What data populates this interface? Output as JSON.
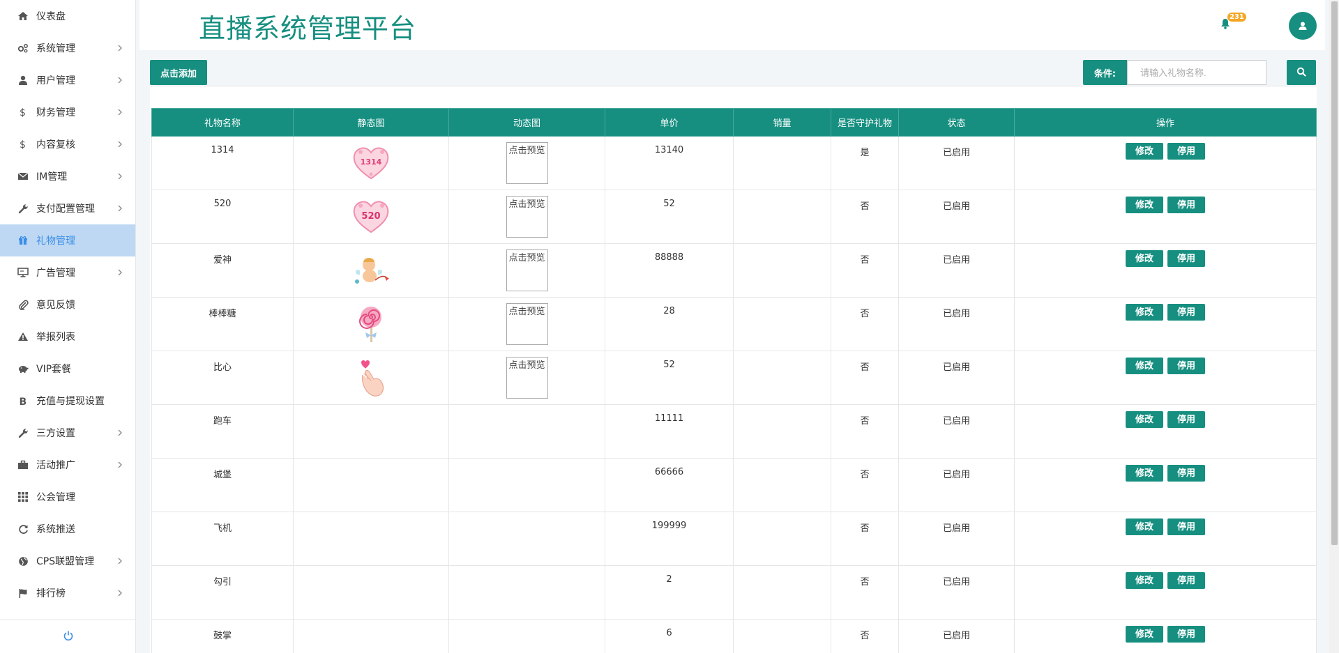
{
  "header": {
    "title": "直播系统管理平台",
    "notification_count": "231"
  },
  "sidebar": {
    "items": [
      {
        "label": "仪表盘",
        "icon": "home-icon",
        "has_children": false
      },
      {
        "label": "系统管理",
        "icon": "gears-icon",
        "has_children": true
      },
      {
        "label": "用户管理",
        "icon": "user-icon",
        "has_children": true
      },
      {
        "label": "财务管理",
        "icon": "dollar-icon",
        "has_children": true
      },
      {
        "label": "内容复核",
        "icon": "dollar-icon",
        "has_children": true
      },
      {
        "label": "IM管理",
        "icon": "envelope-icon",
        "has_children": true
      },
      {
        "label": "支付配置管理",
        "icon": "wrench-icon",
        "has_children": true
      },
      {
        "label": "礼物管理",
        "icon": "gift-icon",
        "has_children": false,
        "active": true
      },
      {
        "label": "广告管理",
        "icon": "monitor-icon",
        "has_children": true
      },
      {
        "label": "意见反馈",
        "icon": "paperclip-icon",
        "has_children": false
      },
      {
        "label": "举报列表",
        "icon": "warning-icon",
        "has_children": false
      },
      {
        "label": "VIP套餐",
        "icon": "piggy-bank-icon",
        "has_children": false
      },
      {
        "label": "充值与提现设置",
        "icon": "bitcoin-icon",
        "has_children": false
      },
      {
        "label": "三方设置",
        "icon": "wrench-icon",
        "has_children": true
      },
      {
        "label": "活动推广",
        "icon": "briefcase-icon",
        "has_children": true
      },
      {
        "label": "公会管理",
        "icon": "grid-icon",
        "has_children": false
      },
      {
        "label": "系统推送",
        "icon": "refresh-icon",
        "has_children": false
      },
      {
        "label": "CPS联盟管理",
        "icon": "globe-icon",
        "has_children": true
      },
      {
        "label": "排行榜",
        "icon": "flag-icon",
        "has_children": true
      }
    ]
  },
  "toolbar": {
    "add_label": "点击添加",
    "condition_label": "条件:",
    "search_placeholder": "请输入礼物名称."
  },
  "table": {
    "columns": [
      "礼物名称",
      "静态图",
      "动态图",
      "单价",
      "销量",
      "是否守护礼物",
      "状态",
      "操作"
    ],
    "broken_image_alt": "点击预览",
    "edit_label": "修改",
    "disable_label": "停用",
    "rows": [
      {
        "name": "1314",
        "static": "heart-1314",
        "dynamic": true,
        "price": "13140",
        "sales": "",
        "guard": "是",
        "status": "已启用"
      },
      {
        "name": "520",
        "static": "heart-520",
        "dynamic": true,
        "price": "52",
        "sales": "",
        "guard": "否",
        "status": "已启用"
      },
      {
        "name": "爱神",
        "static": "cupid",
        "dynamic": true,
        "price": "88888",
        "sales": "",
        "guard": "否",
        "status": "已启用"
      },
      {
        "name": "棒棒糖",
        "static": "lollipop",
        "dynamic": true,
        "price": "28",
        "sales": "",
        "guard": "否",
        "status": "已启用"
      },
      {
        "name": "比心",
        "static": "finger-heart",
        "dynamic": true,
        "price": "52",
        "sales": "",
        "guard": "否",
        "status": "已启用"
      },
      {
        "name": "跑车",
        "static": "",
        "dynamic": false,
        "price": "11111",
        "sales": "",
        "guard": "否",
        "status": "已启用"
      },
      {
        "name": "城堡",
        "static": "",
        "dynamic": false,
        "price": "66666",
        "sales": "",
        "guard": "否",
        "status": "已启用"
      },
      {
        "name": "飞机",
        "static": "",
        "dynamic": false,
        "price": "199999",
        "sales": "",
        "guard": "否",
        "status": "已启用"
      },
      {
        "name": "勾引",
        "static": "",
        "dynamic": false,
        "price": "2",
        "sales": "",
        "guard": "否",
        "status": "已启用"
      },
      {
        "name": "鼓掌",
        "static": "",
        "dynamic": false,
        "price": "6",
        "sales": "",
        "guard": "否",
        "status": "已启用"
      }
    ]
  },
  "colors": {
    "primary": "#168f80",
    "active_nav_bg": "#bed8f3",
    "badge": "#f5a623"
  }
}
